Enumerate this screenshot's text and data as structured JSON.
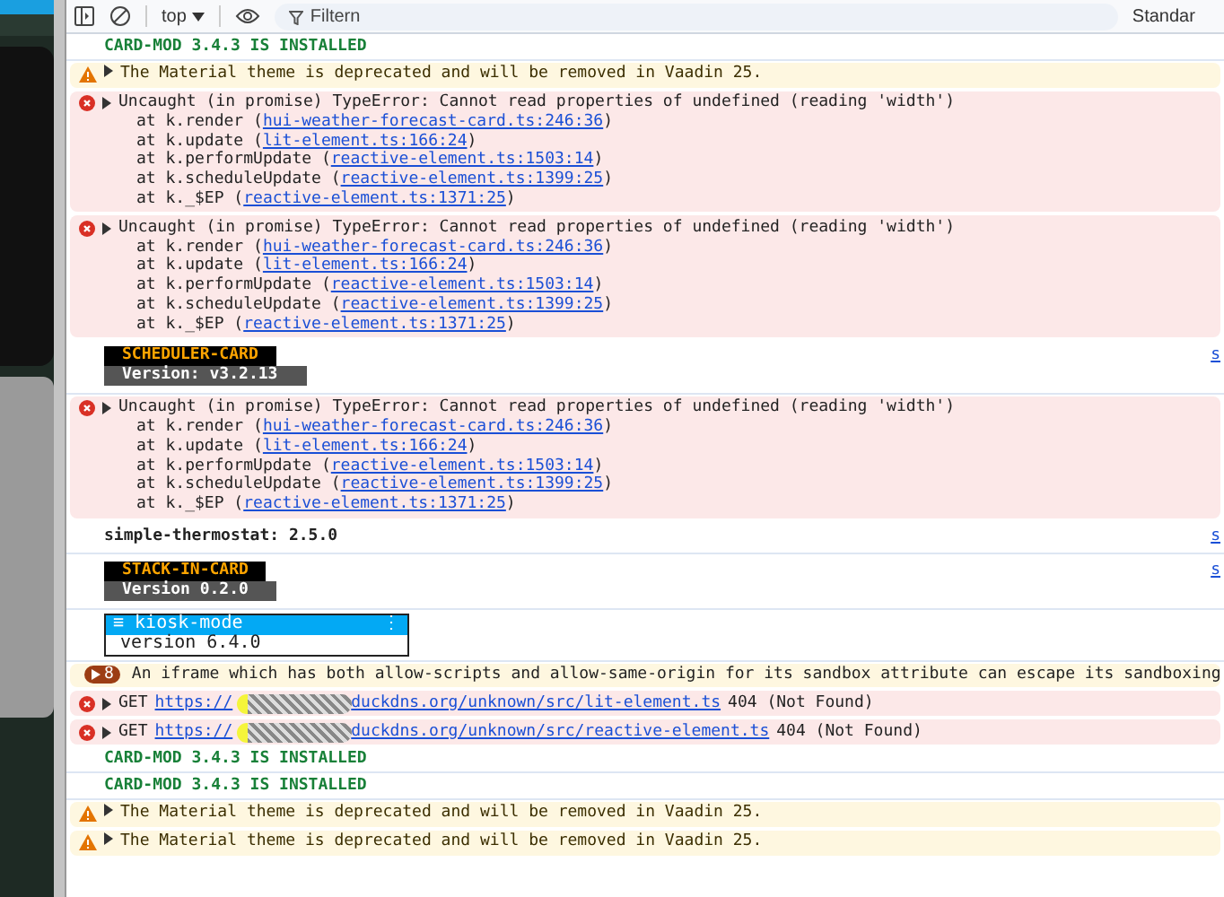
{
  "toolbar": {
    "context": "top",
    "filter": {
      "placeholder": "Filtern"
    },
    "levels": "Standar"
  },
  "entries": [
    {
      "kind": "log",
      "text": "CARD-MOD 3.4.3 IS INSTALLED"
    },
    {
      "kind": "warning",
      "text": "The Material theme is deprecated and will be removed in Vaadin 25."
    },
    {
      "kind": "error",
      "text": "Uncaught (in promise) TypeError: Cannot read properties of undefined (reading 'width')",
      "stack": [
        {
          "caller": "at k.render (",
          "link": "hui-weather-forecast-card.ts:246:36",
          "close": ")"
        },
        {
          "caller": "at k.update (",
          "link": "lit-element.ts:166:24",
          "close": ")"
        },
        {
          "caller": "at k.performUpdate (",
          "link": "reactive-element.ts:1503:14",
          "close": ")"
        },
        {
          "caller": "at k.scheduleUpdate (",
          "link": "reactive-element.ts:1399:25",
          "close": ")"
        },
        {
          "caller": "at k._$EP (",
          "link": "reactive-element.ts:1371:25",
          "close": ")"
        }
      ]
    },
    {
      "kind": "error",
      "text": "Uncaught (in promise) TypeError: Cannot read properties of undefined (reading 'width')",
      "stack": [
        {
          "caller": "at k.render (",
          "link": "hui-weather-forecast-card.ts:246:36",
          "close": ")"
        },
        {
          "caller": "at k.update (",
          "link": "lit-element.ts:166:24",
          "close": ")"
        },
        {
          "caller": "at k.performUpdate (",
          "link": "reactive-element.ts:1503:14",
          "close": ")"
        },
        {
          "caller": "at k.scheduleUpdate (",
          "link": "reactive-element.ts:1399:25",
          "close": ")"
        },
        {
          "caller": "at k._$EP (",
          "link": "reactive-element.ts:1371:25",
          "close": ")"
        }
      ]
    },
    {
      "kind": "badge",
      "title": "SCHEDULER-CARD",
      "version": "Version: v3.2.13",
      "source": "s"
    },
    {
      "kind": "error",
      "text": "Uncaught (in promise) TypeError: Cannot read properties of undefined (reading 'width')",
      "stack": [
        {
          "caller": "at k.render (",
          "link": "hui-weather-forecast-card.ts:246:36",
          "close": ")"
        },
        {
          "caller": "at k.update (",
          "link": "lit-element.ts:166:24",
          "close": ")"
        },
        {
          "caller": "at k.performUpdate (",
          "link": "reactive-element.ts:1503:14",
          "close": ")"
        },
        {
          "caller": "at k.scheduleUpdate (",
          "link": "reactive-element.ts:1399:25",
          "close": ")"
        },
        {
          "caller": "at k._$EP (",
          "link": "reactive-element.ts:1371:25",
          "close": ")"
        }
      ]
    },
    {
      "kind": "plain",
      "text": "simple-thermostat: 2.5.0",
      "source": "s"
    },
    {
      "kind": "badge",
      "title": "STACK-IN-CARD",
      "version": "Version 0.2.0",
      "source": "s"
    },
    {
      "kind": "kiosk",
      "title": "≡ kiosk-mode",
      "menu": "⋮",
      "version": "version 6.4.0"
    },
    {
      "kind": "issue",
      "count": "8",
      "text": "An iframe which has both allow-scripts and allow-same-origin for its sandbox attribute can escape its sandboxing"
    },
    {
      "kind": "network",
      "method": "GET",
      "url_start": "https://",
      "url_end": "duckdns.org/unknown/src/lit-element.ts",
      "status": "404 (Not Found)"
    },
    {
      "kind": "network",
      "method": "GET",
      "url_start": "https://",
      "url_end": "duckdns.org/unknown/src/reactive-element.ts",
      "status": "404 (Not Found)"
    },
    {
      "kind": "log",
      "text": "CARD-MOD 3.4.3 IS INSTALLED"
    },
    {
      "kind": "log",
      "text": "CARD-MOD 3.4.3 IS INSTALLED"
    },
    {
      "kind": "warning",
      "text": "The Material theme is deprecated and will be removed in Vaadin 25."
    },
    {
      "kind": "warning",
      "text": "The Material theme is deprecated and will be removed in Vaadin 25."
    }
  ]
}
